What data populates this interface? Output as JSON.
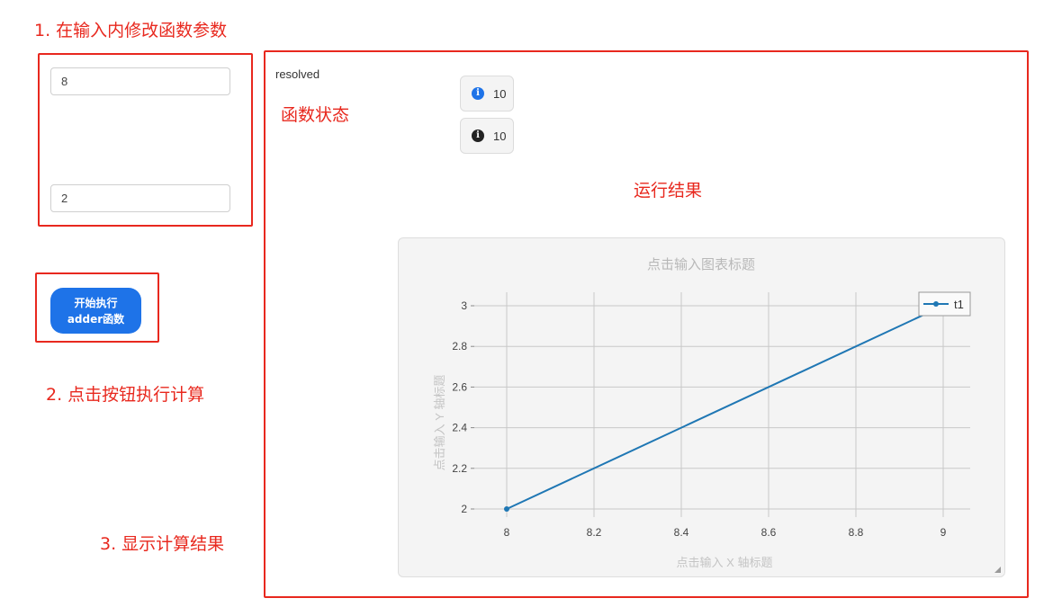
{
  "annotations": {
    "step1": "1. 在输入内修改函数参数",
    "step2": "2. 点击按钮执行计算",
    "step3": "3. 显示计算结果",
    "status_label": "函数状态",
    "result_label": "运行结果"
  },
  "inputs": {
    "param_a": "8",
    "param_b": "2"
  },
  "run_button": {
    "line1": "开始执行",
    "line2": "adder函数"
  },
  "status": "resolved",
  "results": [
    {
      "icon": "info-circle-blue-icon",
      "color": "#1e73e8",
      "value": "10"
    },
    {
      "icon": "info-circle-dark-icon",
      "color": "#222222",
      "value": "10"
    }
  ],
  "chart_data": {
    "type": "line",
    "title": "点击输入图表标题",
    "xlabel": "点击输入 X 轴标题",
    "ylabel": "点击输入 Y 轴标题",
    "x": [
      8,
      9
    ],
    "series": [
      {
        "name": "t1",
        "values": [
          2,
          3
        ],
        "color": "#1f77b4"
      }
    ],
    "xlim": [
      8,
      9
    ],
    "ylim": [
      2,
      3
    ],
    "xticks": [
      8,
      8.2,
      8.4,
      8.6,
      8.8,
      9
    ],
    "yticks": [
      2,
      2.2,
      2.4,
      2.6,
      2.8,
      3
    ],
    "grid": true,
    "legend": "top-right"
  },
  "colors": {
    "annotation_red": "#e8281e",
    "button_blue": "#1e73e8",
    "panel_bg": "#f4f4f4"
  }
}
